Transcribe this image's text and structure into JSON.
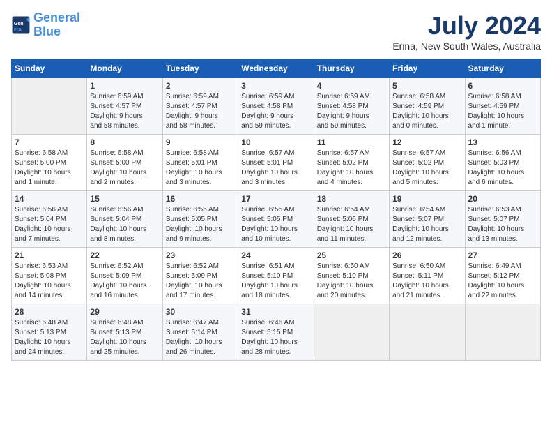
{
  "logo": {
    "line1": "General",
    "line2": "Blue"
  },
  "title": "July 2024",
  "location": "Erina, New South Wales, Australia",
  "days_of_week": [
    "Sunday",
    "Monday",
    "Tuesday",
    "Wednesday",
    "Thursday",
    "Friday",
    "Saturday"
  ],
  "weeks": [
    [
      {
        "day": "",
        "info": ""
      },
      {
        "day": "1",
        "info": "Sunrise: 6:59 AM\nSunset: 4:57 PM\nDaylight: 9 hours\nand 58 minutes."
      },
      {
        "day": "2",
        "info": "Sunrise: 6:59 AM\nSunset: 4:57 PM\nDaylight: 9 hours\nand 58 minutes."
      },
      {
        "day": "3",
        "info": "Sunrise: 6:59 AM\nSunset: 4:58 PM\nDaylight: 9 hours\nand 59 minutes."
      },
      {
        "day": "4",
        "info": "Sunrise: 6:59 AM\nSunset: 4:58 PM\nDaylight: 9 hours\nand 59 minutes."
      },
      {
        "day": "5",
        "info": "Sunrise: 6:58 AM\nSunset: 4:59 PM\nDaylight: 10 hours\nand 0 minutes."
      },
      {
        "day": "6",
        "info": "Sunrise: 6:58 AM\nSunset: 4:59 PM\nDaylight: 10 hours\nand 1 minute."
      }
    ],
    [
      {
        "day": "7",
        "info": "Sunrise: 6:58 AM\nSunset: 5:00 PM\nDaylight: 10 hours\nand 1 minute."
      },
      {
        "day": "8",
        "info": "Sunrise: 6:58 AM\nSunset: 5:00 PM\nDaylight: 10 hours\nand 2 minutes."
      },
      {
        "day": "9",
        "info": "Sunrise: 6:58 AM\nSunset: 5:01 PM\nDaylight: 10 hours\nand 3 minutes."
      },
      {
        "day": "10",
        "info": "Sunrise: 6:57 AM\nSunset: 5:01 PM\nDaylight: 10 hours\nand 3 minutes."
      },
      {
        "day": "11",
        "info": "Sunrise: 6:57 AM\nSunset: 5:02 PM\nDaylight: 10 hours\nand 4 minutes."
      },
      {
        "day": "12",
        "info": "Sunrise: 6:57 AM\nSunset: 5:02 PM\nDaylight: 10 hours\nand 5 minutes."
      },
      {
        "day": "13",
        "info": "Sunrise: 6:56 AM\nSunset: 5:03 PM\nDaylight: 10 hours\nand 6 minutes."
      }
    ],
    [
      {
        "day": "14",
        "info": "Sunrise: 6:56 AM\nSunset: 5:04 PM\nDaylight: 10 hours\nand 7 minutes."
      },
      {
        "day": "15",
        "info": "Sunrise: 6:56 AM\nSunset: 5:04 PM\nDaylight: 10 hours\nand 8 minutes."
      },
      {
        "day": "16",
        "info": "Sunrise: 6:55 AM\nSunset: 5:05 PM\nDaylight: 10 hours\nand 9 minutes."
      },
      {
        "day": "17",
        "info": "Sunrise: 6:55 AM\nSunset: 5:05 PM\nDaylight: 10 hours\nand 10 minutes."
      },
      {
        "day": "18",
        "info": "Sunrise: 6:54 AM\nSunset: 5:06 PM\nDaylight: 10 hours\nand 11 minutes."
      },
      {
        "day": "19",
        "info": "Sunrise: 6:54 AM\nSunset: 5:07 PM\nDaylight: 10 hours\nand 12 minutes."
      },
      {
        "day": "20",
        "info": "Sunrise: 6:53 AM\nSunset: 5:07 PM\nDaylight: 10 hours\nand 13 minutes."
      }
    ],
    [
      {
        "day": "21",
        "info": "Sunrise: 6:53 AM\nSunset: 5:08 PM\nDaylight: 10 hours\nand 14 minutes."
      },
      {
        "day": "22",
        "info": "Sunrise: 6:52 AM\nSunset: 5:09 PM\nDaylight: 10 hours\nand 16 minutes."
      },
      {
        "day": "23",
        "info": "Sunrise: 6:52 AM\nSunset: 5:09 PM\nDaylight: 10 hours\nand 17 minutes."
      },
      {
        "day": "24",
        "info": "Sunrise: 6:51 AM\nSunset: 5:10 PM\nDaylight: 10 hours\nand 18 minutes."
      },
      {
        "day": "25",
        "info": "Sunrise: 6:50 AM\nSunset: 5:10 PM\nDaylight: 10 hours\nand 20 minutes."
      },
      {
        "day": "26",
        "info": "Sunrise: 6:50 AM\nSunset: 5:11 PM\nDaylight: 10 hours\nand 21 minutes."
      },
      {
        "day": "27",
        "info": "Sunrise: 6:49 AM\nSunset: 5:12 PM\nDaylight: 10 hours\nand 22 minutes."
      }
    ],
    [
      {
        "day": "28",
        "info": "Sunrise: 6:48 AM\nSunset: 5:13 PM\nDaylight: 10 hours\nand 24 minutes."
      },
      {
        "day": "29",
        "info": "Sunrise: 6:48 AM\nSunset: 5:13 PM\nDaylight: 10 hours\nand 25 minutes."
      },
      {
        "day": "30",
        "info": "Sunrise: 6:47 AM\nSunset: 5:14 PM\nDaylight: 10 hours\nand 26 minutes."
      },
      {
        "day": "31",
        "info": "Sunrise: 6:46 AM\nSunset: 5:15 PM\nDaylight: 10 hours\nand 28 minutes."
      },
      {
        "day": "",
        "info": ""
      },
      {
        "day": "",
        "info": ""
      },
      {
        "day": "",
        "info": ""
      }
    ]
  ]
}
